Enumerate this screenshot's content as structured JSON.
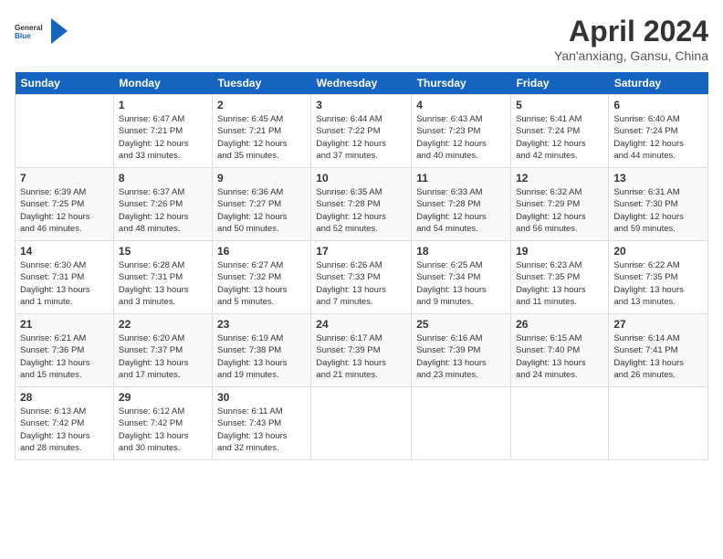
{
  "logo": {
    "line1": "General",
    "line2": "Blue"
  },
  "title": "April 2024",
  "subtitle": "Yan'anxiang, Gansu, China",
  "weekdays": [
    "Sunday",
    "Monday",
    "Tuesday",
    "Wednesday",
    "Thursday",
    "Friday",
    "Saturday"
  ],
  "weeks": [
    [
      {
        "day": "",
        "info": ""
      },
      {
        "day": "1",
        "info": "Sunrise: 6:47 AM\nSunset: 7:21 PM\nDaylight: 12 hours\nand 33 minutes."
      },
      {
        "day": "2",
        "info": "Sunrise: 6:45 AM\nSunset: 7:21 PM\nDaylight: 12 hours\nand 35 minutes."
      },
      {
        "day": "3",
        "info": "Sunrise: 6:44 AM\nSunset: 7:22 PM\nDaylight: 12 hours\nand 37 minutes."
      },
      {
        "day": "4",
        "info": "Sunrise: 6:43 AM\nSunset: 7:23 PM\nDaylight: 12 hours\nand 40 minutes."
      },
      {
        "day": "5",
        "info": "Sunrise: 6:41 AM\nSunset: 7:24 PM\nDaylight: 12 hours\nand 42 minutes."
      },
      {
        "day": "6",
        "info": "Sunrise: 6:40 AM\nSunset: 7:24 PM\nDaylight: 12 hours\nand 44 minutes."
      }
    ],
    [
      {
        "day": "7",
        "info": "Sunrise: 6:39 AM\nSunset: 7:25 PM\nDaylight: 12 hours\nand 46 minutes."
      },
      {
        "day": "8",
        "info": "Sunrise: 6:37 AM\nSunset: 7:26 PM\nDaylight: 12 hours\nand 48 minutes."
      },
      {
        "day": "9",
        "info": "Sunrise: 6:36 AM\nSunset: 7:27 PM\nDaylight: 12 hours\nand 50 minutes."
      },
      {
        "day": "10",
        "info": "Sunrise: 6:35 AM\nSunset: 7:28 PM\nDaylight: 12 hours\nand 52 minutes."
      },
      {
        "day": "11",
        "info": "Sunrise: 6:33 AM\nSunset: 7:28 PM\nDaylight: 12 hours\nand 54 minutes."
      },
      {
        "day": "12",
        "info": "Sunrise: 6:32 AM\nSunset: 7:29 PM\nDaylight: 12 hours\nand 56 minutes."
      },
      {
        "day": "13",
        "info": "Sunrise: 6:31 AM\nSunset: 7:30 PM\nDaylight: 12 hours\nand 59 minutes."
      }
    ],
    [
      {
        "day": "14",
        "info": "Sunrise: 6:30 AM\nSunset: 7:31 PM\nDaylight: 13 hours\nand 1 minute."
      },
      {
        "day": "15",
        "info": "Sunrise: 6:28 AM\nSunset: 7:31 PM\nDaylight: 13 hours\nand 3 minutes."
      },
      {
        "day": "16",
        "info": "Sunrise: 6:27 AM\nSunset: 7:32 PM\nDaylight: 13 hours\nand 5 minutes."
      },
      {
        "day": "17",
        "info": "Sunrise: 6:26 AM\nSunset: 7:33 PM\nDaylight: 13 hours\nand 7 minutes."
      },
      {
        "day": "18",
        "info": "Sunrise: 6:25 AM\nSunset: 7:34 PM\nDaylight: 13 hours\nand 9 minutes."
      },
      {
        "day": "19",
        "info": "Sunrise: 6:23 AM\nSunset: 7:35 PM\nDaylight: 13 hours\nand 11 minutes."
      },
      {
        "day": "20",
        "info": "Sunrise: 6:22 AM\nSunset: 7:35 PM\nDaylight: 13 hours\nand 13 minutes."
      }
    ],
    [
      {
        "day": "21",
        "info": "Sunrise: 6:21 AM\nSunset: 7:36 PM\nDaylight: 13 hours\nand 15 minutes."
      },
      {
        "day": "22",
        "info": "Sunrise: 6:20 AM\nSunset: 7:37 PM\nDaylight: 13 hours\nand 17 minutes."
      },
      {
        "day": "23",
        "info": "Sunrise: 6:19 AM\nSunset: 7:38 PM\nDaylight: 13 hours\nand 19 minutes."
      },
      {
        "day": "24",
        "info": "Sunrise: 6:17 AM\nSunset: 7:39 PM\nDaylight: 13 hours\nand 21 minutes."
      },
      {
        "day": "25",
        "info": "Sunrise: 6:16 AM\nSunset: 7:39 PM\nDaylight: 13 hours\nand 23 minutes."
      },
      {
        "day": "26",
        "info": "Sunrise: 6:15 AM\nSunset: 7:40 PM\nDaylight: 13 hours\nand 24 minutes."
      },
      {
        "day": "27",
        "info": "Sunrise: 6:14 AM\nSunset: 7:41 PM\nDaylight: 13 hours\nand 26 minutes."
      }
    ],
    [
      {
        "day": "28",
        "info": "Sunrise: 6:13 AM\nSunset: 7:42 PM\nDaylight: 13 hours\nand 28 minutes."
      },
      {
        "day": "29",
        "info": "Sunrise: 6:12 AM\nSunset: 7:42 PM\nDaylight: 13 hours\nand 30 minutes."
      },
      {
        "day": "30",
        "info": "Sunrise: 6:11 AM\nSunset: 7:43 PM\nDaylight: 13 hours\nand 32 minutes."
      },
      {
        "day": "",
        "info": ""
      },
      {
        "day": "",
        "info": ""
      },
      {
        "day": "",
        "info": ""
      },
      {
        "day": "",
        "info": ""
      }
    ]
  ]
}
